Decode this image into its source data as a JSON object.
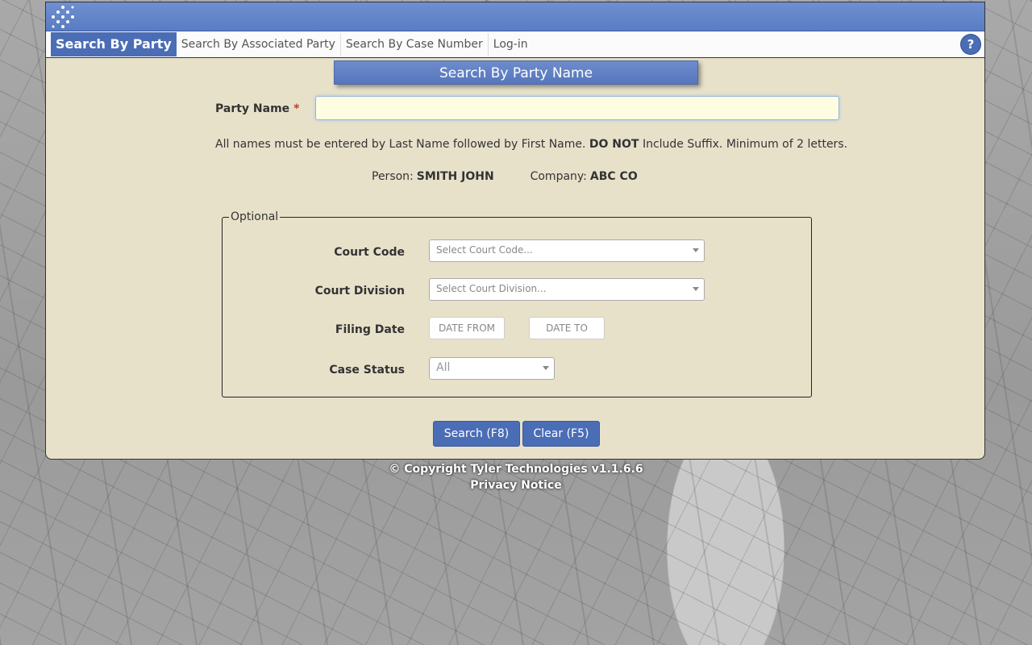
{
  "tabs": {
    "party": "Search By Party",
    "associated": "Search By Associated Party",
    "case_number": "Search By Case Number",
    "login": "Log-in"
  },
  "help_label": "?",
  "form": {
    "title": "Search By Party Name",
    "party_label": "Party Name",
    "required_mark": "*",
    "party_value": "",
    "hint_before": "All names must be entered by Last Name followed by First Name.",
    "hint_bold": "DO NOT",
    "hint_after": "Include Suffix. Minimum of 2 letters.",
    "person_label": "Person:",
    "person_example": "SMITH JOHN",
    "company_label": "Company:",
    "company_example": "ABC CO"
  },
  "optional": {
    "legend": "Optional",
    "court_code_label": "Court Code",
    "court_code_placeholder": "Select Court Code...",
    "court_division_label": "Court Division",
    "court_division_placeholder": "Select Court Division...",
    "filing_date_label": "Filing Date",
    "date_from": "DATE FROM",
    "date_to": "DATE TO",
    "case_status_label": "Case Status",
    "case_status_value": "All"
  },
  "buttons": {
    "search": "Search (F8)",
    "clear": "Clear (F5)"
  },
  "footer": {
    "copyright": "© Copyright Tyler Technologies v1.1.6.6",
    "privacy": "Privacy Notice"
  },
  "colors": {
    "accent": "#4a6db6",
    "panel": "#e8e1ca",
    "required": "#c0392b"
  }
}
